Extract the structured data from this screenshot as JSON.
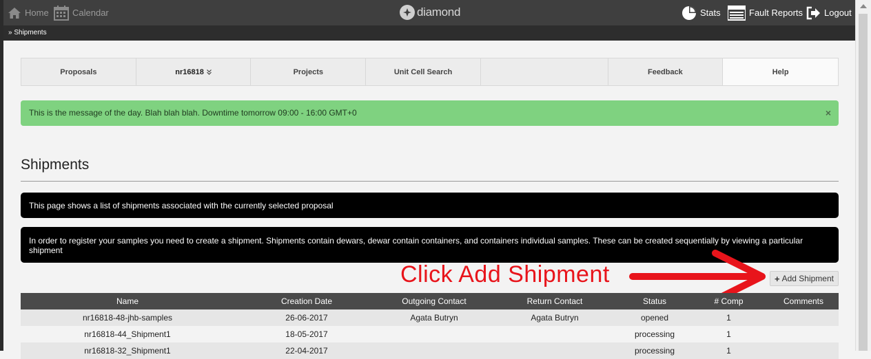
{
  "topbar": {
    "home_label": "Home",
    "calendar_label": "Calendar",
    "logo_text": "diamond",
    "stats_label": "Stats",
    "fault_reports_label": "Fault Reports",
    "logout_label": "Logout"
  },
  "breadcrumb": "» Shipments",
  "subnav": [
    {
      "label": "Proposals"
    },
    {
      "label": "nr16818",
      "has_chevron": true
    },
    {
      "label": "Projects"
    },
    {
      "label": "Unit Cell Search"
    },
    {
      "label": ""
    },
    {
      "label": "Feedback"
    },
    {
      "label": "Help"
    }
  ],
  "message_of_day": {
    "text": "This is the message of the day. Blah blah blah. Downtime tomorrow 09:00 - 16:00 GMT+0",
    "close": "×"
  },
  "page_title": "Shipments",
  "info": {
    "line1": "This page shows a list of shipments associated with the currently selected proposal",
    "line2": "In order to register your samples you need to create a shipment. Shipments contain dewars, dewar contain containers, and containers individual samples. These can be created sequentially by viewing a particular shipment"
  },
  "annotation": "Click Add Shipment",
  "add_button_label": "Add Shipment",
  "table": {
    "headers": [
      "Name",
      "Creation Date",
      "Outgoing Contact",
      "Return Contact",
      "Status",
      "# Comp",
      "Comments"
    ],
    "rows": [
      [
        "nr16818-48-jhb-samples",
        "26-06-2017",
        "Agata Butryn",
        "Agata Butryn",
        "opened",
        "1",
        ""
      ],
      [
        "nr16818-44_Shipment1",
        "18-05-2017",
        "",
        "",
        "processing",
        "1",
        ""
      ],
      [
        "nr16818-32_Shipment1",
        "22-04-2017",
        "",
        "",
        "processing",
        "1",
        ""
      ]
    ]
  },
  "colors": {
    "topbar": "#3f3f3f",
    "motd_bg": "#7fd280",
    "annotation": "#e8141b",
    "table_header": "#4a4a4a"
  }
}
